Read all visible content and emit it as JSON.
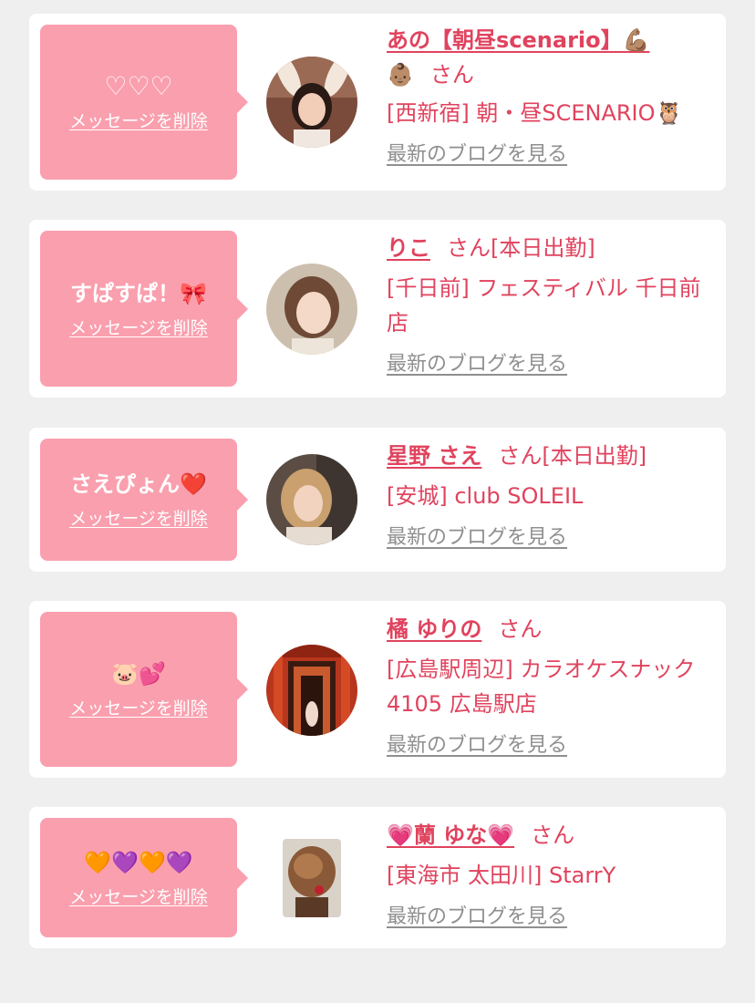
{
  "favorites": [
    {
      "message": "♡♡♡",
      "delete_label": "メッセージを削除",
      "name": "あの【朝昼scenario】💪🏽",
      "name_suffix": "👶🏽",
      "honorific": "さん",
      "shop": "[西新宿] 朝・昼SCENARIO🦉",
      "blog_label": "最新のブログを見る",
      "avatar_icon": "girl-bunny-ears-avatar"
    },
    {
      "message": "すぱすぱ！🎀",
      "delete_label": "メッセージを削除",
      "name": "りこ",
      "name_suffix": "",
      "honorific": "さん[本日出勤]",
      "shop": "[千日前] フェスティバル 千日前店",
      "blog_label": "最新のブログを見る",
      "avatar_icon": "girl-portrait-avatar"
    },
    {
      "message": "さえぴょん❤️",
      "delete_label": "メッセージを削除",
      "name": "星野 さえ",
      "name_suffix": "",
      "honorific": "さん[本日出勤]",
      "shop": "[安城] club SOLEIL",
      "blog_label": "最新のブログを見る",
      "avatar_icon": "girl-blonde-avatar"
    },
    {
      "message": "🐷💕",
      "delete_label": "メッセージを削除",
      "name": "橘 ゆりの",
      "name_suffix": "",
      "honorific": "さん",
      "shop": "[広島駅周辺] カラオケスナック 4105 広島駅店",
      "blog_label": "最新のブログを見る",
      "avatar_icon": "torii-gates-avatar"
    },
    {
      "message": "🧡💜🧡💜",
      "delete_label": "メッセージを削除",
      "name": "💗蘭 ゆな💗",
      "name_suffix": "",
      "honorific": "さん",
      "shop": "[東海市 太田川] StarrY",
      "blog_label": "最新のブログを見る",
      "avatar_icon": "hair-updo-avatar"
    }
  ],
  "colors": {
    "page_bg": "#efefef",
    "card_bg": "#ffffff",
    "bubble_bg": "#fa9fae",
    "accent_pink": "#e0435e",
    "link_gray": "#8f8f8f"
  }
}
